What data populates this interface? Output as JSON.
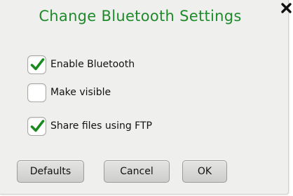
{
  "dialog": {
    "title": "Change Bluetooth Settings",
    "close_icon": "close-x-icon",
    "title_color": "#1f8a2c"
  },
  "options": [
    {
      "label": "Enable Bluetooth",
      "checked": true
    },
    {
      "label": "Make visible",
      "checked": false
    },
    {
      "label": "Share files using FTP",
      "checked": true
    }
  ],
  "buttons": {
    "defaults": "Defaults",
    "cancel": "Cancel",
    "ok": "OK"
  },
  "check_color": "#1a8a1f"
}
